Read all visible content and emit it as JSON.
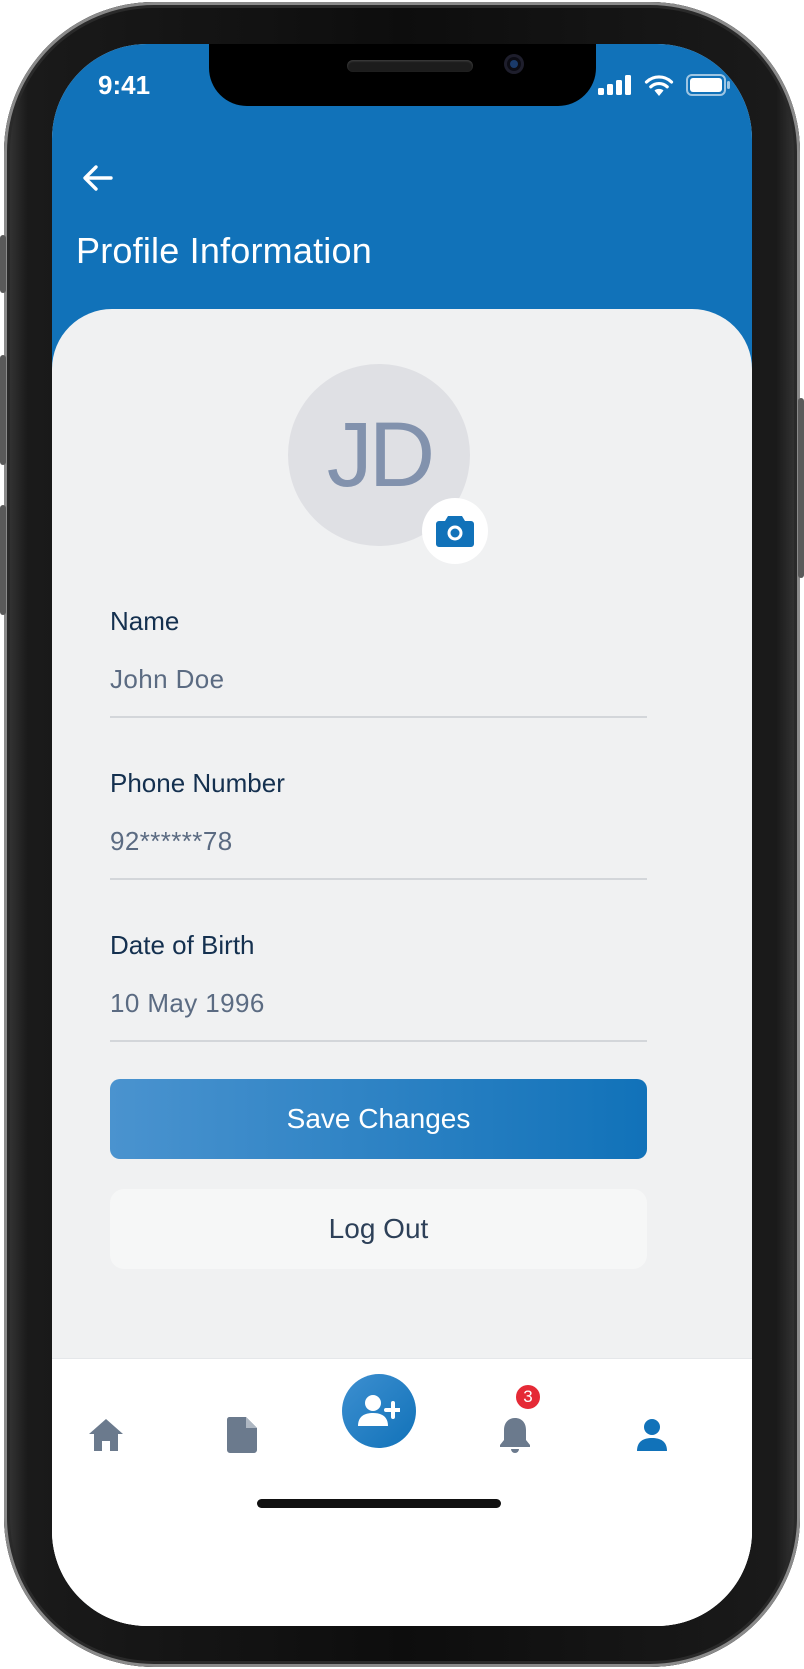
{
  "status_bar": {
    "time": "9:41"
  },
  "header": {
    "title": "Profile Information"
  },
  "profile": {
    "initials": "JD"
  },
  "fields": {
    "name": {
      "label": "Name",
      "value": "John Doe"
    },
    "phone": {
      "label": "Phone Number",
      "value": "92******78"
    },
    "dob": {
      "label": "Date of Birth",
      "value": "10 May 1996"
    }
  },
  "actions": {
    "save_label": "Save Changes",
    "logout_label": "Log Out"
  },
  "bottom_nav": {
    "items": [
      "home-icon",
      "document-icon",
      "add-person-icon",
      "bell-icon",
      "person-icon"
    ],
    "notification_count": "3",
    "active": "person-icon"
  },
  "colors": {
    "primary": "#1172b9",
    "background": "#f0f1f2",
    "badge": "#e52a36",
    "inactive_icon": "#6b7a8d"
  }
}
